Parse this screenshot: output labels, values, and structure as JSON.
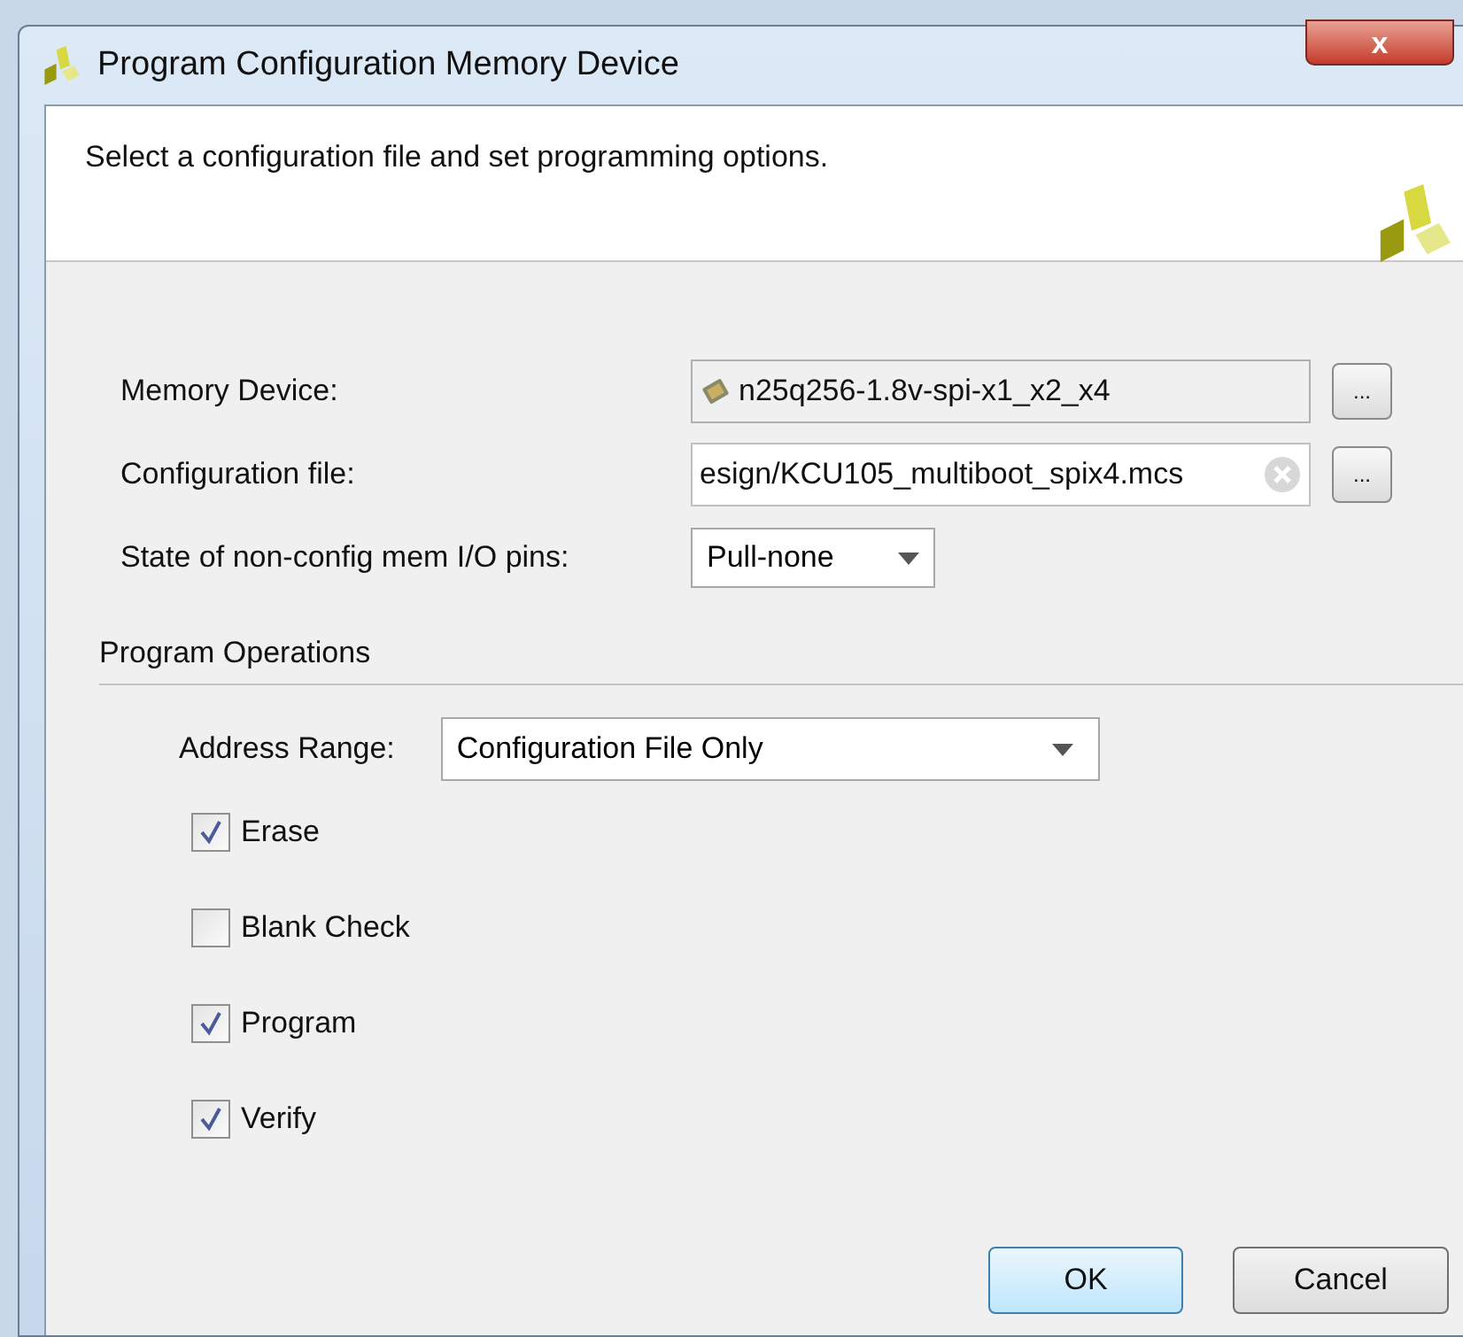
{
  "window": {
    "title": "Program Configuration Memory Device",
    "close": "x"
  },
  "header": {
    "text": "Select a configuration file and set programming options."
  },
  "fields": [
    {
      "kind": "device",
      "label": "Memory Device:",
      "value": "n25q256-1.8v-spi-x1_x2_x4",
      "browse": "..."
    },
    {
      "kind": "file",
      "label": "Configuration file:",
      "value": "esign/KCU105_multiboot_spix4.mcs",
      "browse": "..."
    },
    {
      "kind": "combo",
      "label": "State of non-config mem I/O pins:",
      "value": "Pull-none"
    }
  ],
  "program_operations": {
    "title": "Program Operations",
    "address_range": {
      "label": "Address Range:",
      "value": "Configuration File Only"
    },
    "options": [
      {
        "label": "Erase",
        "checked": true
      },
      {
        "label": "Blank Check",
        "checked": false
      },
      {
        "label": "Program",
        "checked": true
      },
      {
        "label": "Verify",
        "checked": true
      }
    ]
  },
  "buttons": [
    {
      "label": "OK",
      "selected": true
    },
    {
      "label": "Cancel",
      "selected": false
    }
  ]
}
